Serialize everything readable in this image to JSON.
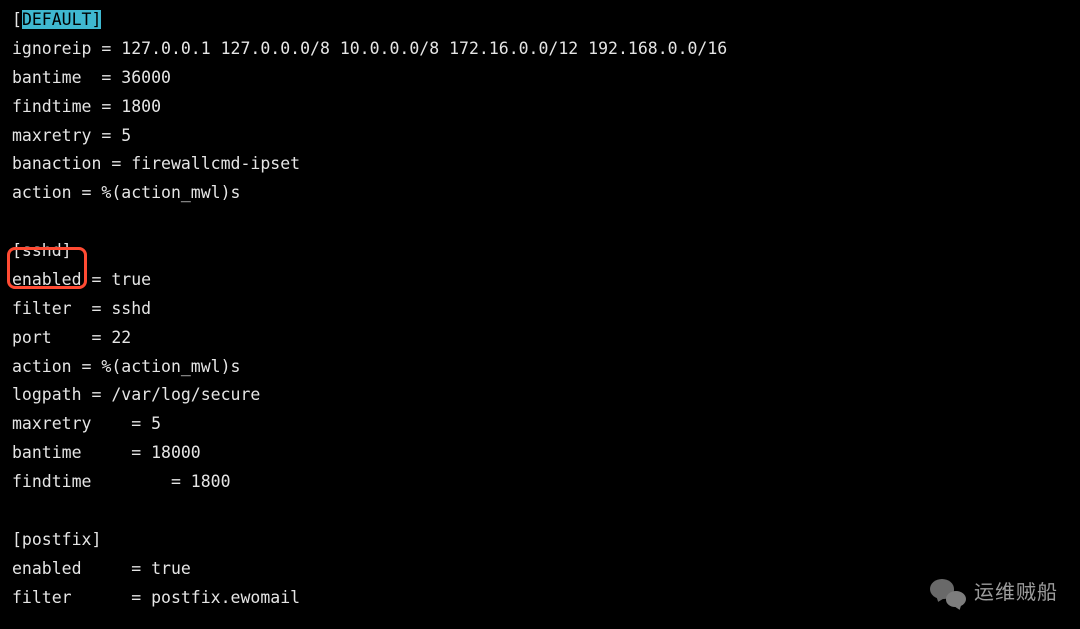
{
  "lines": {
    "l1_prefix": "[",
    "l1_highlight": "DEFAULT]",
    "l2": "ignoreip = 127.0.0.1 127.0.0.0/8 10.0.0.0/8 172.16.0.0/12 192.168.0.0/16",
    "l3": "bantime  = 36000",
    "l4": "findtime = 1800",
    "l5": "maxretry = 5",
    "l6": "banaction = firewallcmd-ipset",
    "l7": "action = %(action_mwl)s",
    "l9": "[sshd]",
    "l10": "enabled = true",
    "l11": "filter  = sshd",
    "l12": "port    = 22",
    "l13": "action = %(action_mwl)s",
    "l14": "logpath = /var/log/secure",
    "l15": "maxretry    = 5",
    "l16": "bantime     = 18000",
    "l17": "findtime        = 1800",
    "l19": "[postfix]",
    "l20": "enabled     = true",
    "l21": "filter      = postfix.ewomail"
  },
  "watermark": {
    "text": "运维贼船"
  },
  "chart_data": {
    "type": "table",
    "title": "fail2ban configuration file excerpt",
    "sections": [
      {
        "name": "DEFAULT",
        "highlighted": true,
        "settings": {
          "ignoreip": "127.0.0.1 127.0.0.0/8 10.0.0.0/8 172.16.0.0/12 192.168.0.0/16",
          "bantime": 36000,
          "findtime": 1800,
          "maxretry": 5,
          "banaction": "firewallcmd-ipset",
          "action": "%(action_mwl)s"
        }
      },
      {
        "name": "sshd",
        "boxed": true,
        "settings": {
          "enabled": true,
          "filter": "sshd",
          "port": 22,
          "action": "%(action_mwl)s",
          "logpath": "/var/log/secure",
          "maxretry": 5,
          "bantime": 18000,
          "findtime": 1800
        }
      },
      {
        "name": "postfix",
        "settings": {
          "enabled": true,
          "filter": "postfix.ewomail"
        }
      }
    ]
  }
}
